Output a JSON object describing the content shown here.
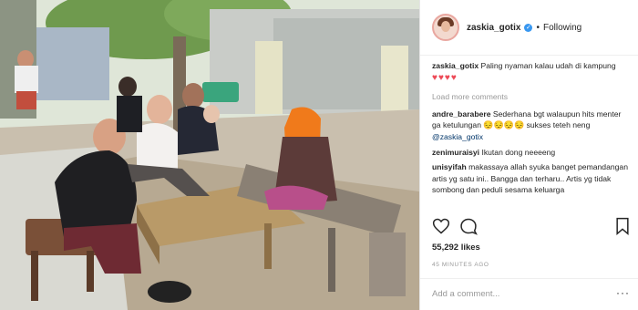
{
  "post": {
    "username": "zaskia_gotix",
    "follow_label": "Following"
  },
  "caption": {
    "username": "zaskia_gotix",
    "text": "Paling nyaman kalau udah di kampung",
    "hearts": "♥♥♥♥"
  },
  "load_more_label": "Load more comments",
  "comments": [
    {
      "username": "andre_barabere",
      "text": "Sederhana bgt walaupun hits menter ga ketulungan",
      "emoji": "😔😔😔😔",
      "extra": "sukses teteh neng",
      "mention": "@zaskia_gotix"
    },
    {
      "username": "zenimuraisyi",
      "text": "Ikutan dong neeeeng"
    },
    {
      "username": "unisyifah",
      "text": "makassaya allah syuka banget pemandangan artis yg satu ini.. Bangga dan terharu.. Artis yg tidak sombong dan peduli sesama keluarga"
    }
  ],
  "likes": "55,292 likes",
  "timestamp": "45 MINUTES AGO",
  "add_comment_placeholder": "Add a comment...",
  "more_options": "···",
  "icons": {
    "like": "heart-icon",
    "comment": "comment-icon",
    "save": "bookmark-icon",
    "verified": "verified-badge-icon"
  },
  "colors": {
    "verified_blue": "#3897f0",
    "heart_red": "#ed4956",
    "mention_blue": "#003569",
    "muted": "#999999"
  }
}
